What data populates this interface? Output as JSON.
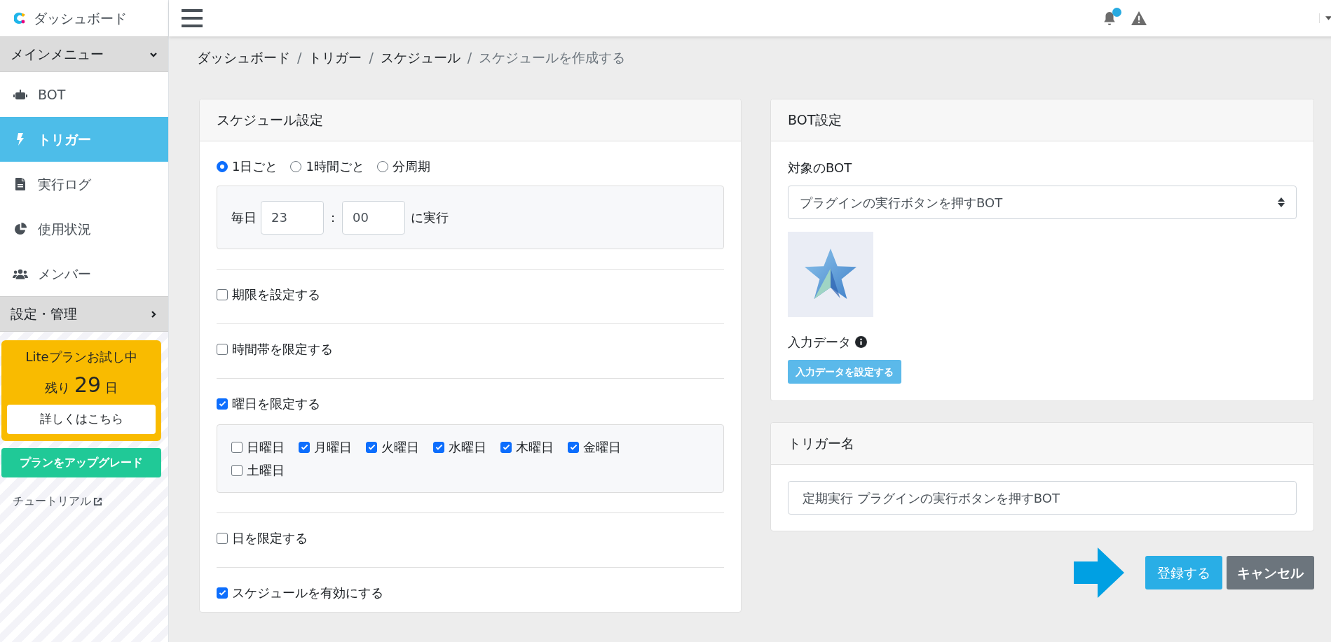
{
  "sidebar": {
    "logo_title": "ダッシュボード",
    "sections": [
      {
        "title": "メインメニュー",
        "expanded": true,
        "items": [
          {
            "label": "BOT",
            "selected": false
          },
          {
            "label": "トリガー",
            "selected": true
          },
          {
            "label": "実行ログ",
            "selected": false
          },
          {
            "label": "使用状況",
            "selected": false
          },
          {
            "label": "メンバー",
            "selected": false
          }
        ]
      },
      {
        "title": "設定・管理",
        "expanded": false
      }
    ],
    "trial": {
      "title": "Liteプランお試し中",
      "remaining_prefix": "残り",
      "days": "29",
      "days_suffix": "日",
      "details_button": "詳しくはこちら"
    },
    "upgrade_button": "プランをアップグレード",
    "tutorial_link": "チュートリアル"
  },
  "topbar": {
    "notification_badge": true
  },
  "breadcrumb": {
    "separator": "/",
    "items": [
      "ダッシュボード",
      "トリガー",
      "スケジュール",
      "スケジュールを作成する"
    ]
  },
  "schedule_card": {
    "title": "スケジュール設定",
    "frequency": [
      {
        "label": "1日ごと",
        "selected": true
      },
      {
        "label": "1時間ごと",
        "selected": false
      },
      {
        "label": "分周期",
        "selected": false
      }
    ],
    "daily": {
      "prefix": "毎日",
      "hour": "23",
      "colon": ":",
      "minute": "00",
      "suffix": "に実行"
    },
    "options": [
      {
        "label": "期限を設定する",
        "checked": false
      },
      {
        "label": "時間帯を限定する",
        "checked": false
      },
      {
        "label": "曜日を限定する",
        "checked": true,
        "days": [
          {
            "label": "日曜日",
            "checked": false
          },
          {
            "label": "月曜日",
            "checked": true
          },
          {
            "label": "火曜日",
            "checked": true
          },
          {
            "label": "水曜日",
            "checked": true
          },
          {
            "label": "木曜日",
            "checked": true
          },
          {
            "label": "金曜日",
            "checked": true
          },
          {
            "label": "土曜日",
            "checked": false
          }
        ]
      },
      {
        "label": "日を限定する",
        "checked": false
      },
      {
        "label": "スケジュールを有効にする",
        "checked": true
      }
    ]
  },
  "bot_card": {
    "title": "BOT設定",
    "target_label": "対象のBOT",
    "target_value": "プラグインの実行ボタンを押すBOT",
    "input_data_label": "入力データ",
    "set_input_button": "入力データを設定する"
  },
  "trigger_name_card": {
    "title": "トリガー名",
    "value": "定期実行 プラグインの実行ボタンを押すBOT"
  },
  "actions": {
    "submit": "登録する",
    "cancel": "キャンセル"
  }
}
